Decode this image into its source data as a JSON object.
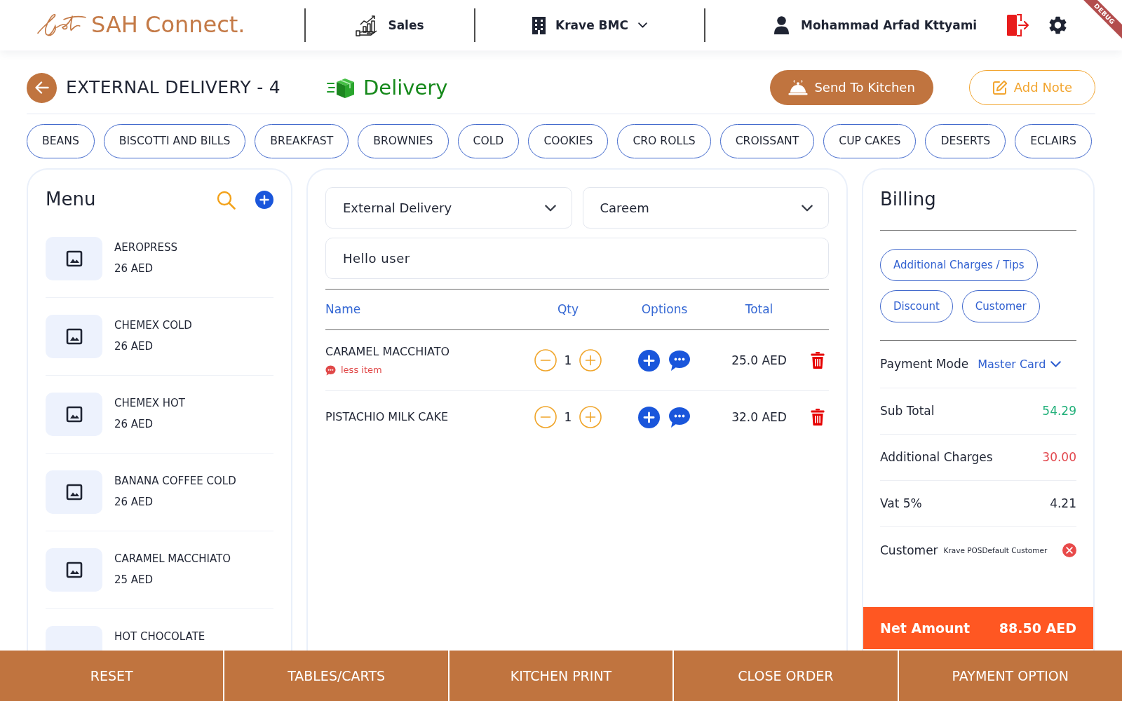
{
  "header": {
    "logo": "SAH Connect.",
    "nav": [
      {
        "kind": "page",
        "label": "Sales"
      },
      {
        "kind": "branch",
        "label": "Krave BMC"
      }
    ],
    "user": "Mohammad Arfad Kttyami",
    "banner": "DEBUG"
  },
  "order": {
    "title": "EXTERNAL DELIVERY - 4",
    "type": "Delivery",
    "actions": [
      {
        "kind": "kitchen",
        "label": "Send To Kitchen"
      },
      {
        "kind": "note",
        "label": "Add Note"
      }
    ]
  },
  "categories": [
    "BEANS",
    "BISCOTTI AND BILLS",
    "BREAKFAST",
    "BROWNIES",
    "COLD",
    "COOKIES",
    "CRO ROLLS",
    "CROISSANT",
    "CUP CAKES",
    "DESERTS",
    "ECLAIRS"
  ],
  "menu": {
    "title": "Menu",
    "items": [
      {
        "name": "AEROPRESS",
        "price": "26 AED"
      },
      {
        "name": "CHEMEX COLD",
        "price": "26 AED"
      },
      {
        "name": "CHEMEX HOT",
        "price": "26 AED"
      },
      {
        "name": "BANANA COFFEE COLD",
        "price": "26 AED"
      },
      {
        "name": "CARAMEL MACCHIATO",
        "price": "25 AED"
      },
      {
        "name": "HOT CHOCOLATE"
      }
    ]
  },
  "order_form": {
    "selects": [
      {
        "value": "External Delivery"
      },
      {
        "value": "Careem"
      }
    ],
    "note_field": {
      "value": "Hello user"
    }
  },
  "cart": {
    "columns": [
      "Name",
      "Qty",
      "Options",
      "Total"
    ],
    "rows": [
      {
        "name": "CARAMEL MACCHIATO",
        "note": "less item",
        "qty": "1",
        "total": "25.0 AED"
      },
      {
        "name": "PISTACHIO MILK CAKE",
        "qty": "1",
        "total": "32.0 AED"
      }
    ]
  },
  "billing": {
    "title": "Billing",
    "buttons": [
      "Additional Charges / Tips",
      "Discount",
      "Customer"
    ],
    "payment": {
      "label": "Payment Mode",
      "value": "Master Card"
    },
    "rows": [
      {
        "label": "Sub Total",
        "value": "54.29",
        "color": "#22b07a"
      },
      {
        "label": "Additional Charges",
        "value": "30.00",
        "color": "#e2474d"
      },
      {
        "label": "Vat 5%",
        "value": "4.21",
        "color": "#1f2433"
      }
    ],
    "customer": {
      "label": "Customer",
      "value": "Krave POSDefault Customer"
    },
    "net": {
      "label": "Net Amount",
      "value": "88.50 AED"
    }
  },
  "footer_buttons": [
    "RESET",
    "TABLES/CARTS",
    "KITCHEN PRINT",
    "CLOSE ORDER",
    "PAYMENT OPTION"
  ]
}
